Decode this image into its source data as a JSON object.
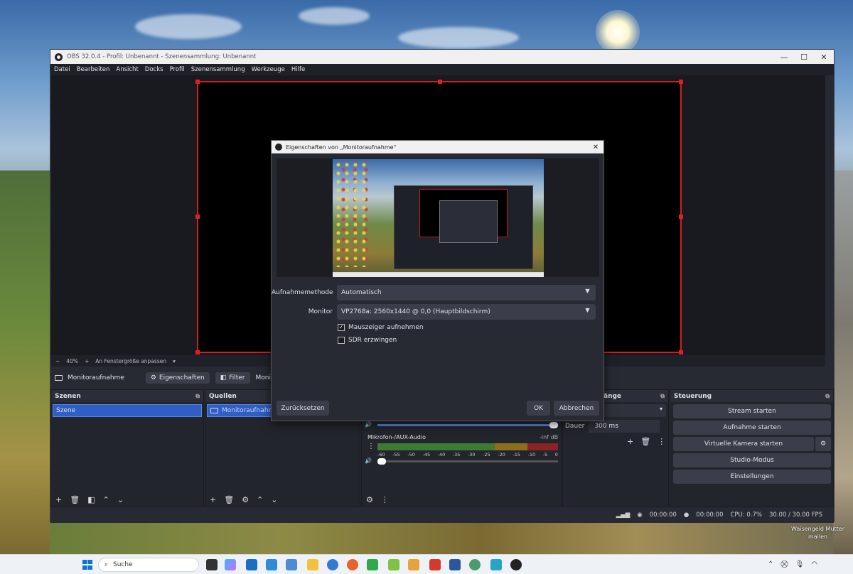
{
  "window": {
    "title": "OBS 32.0.4 - Profil: Unbenannt - Szenensammlung: Unbenannt",
    "controls": [
      "—",
      "☐",
      "✕"
    ]
  },
  "menu": [
    "Datei",
    "Bearbeiten",
    "Ansicht",
    "Docks",
    "Profil",
    "Szenensammlung",
    "Werkzeuge",
    "Hilfe"
  ],
  "zoombar": {
    "minus": "−",
    "zoom": "40%",
    "plus": "+",
    "fit": "An Fenstergröße anpassen",
    "caret": "▾"
  },
  "source_toolbar": {
    "selected_source": "Monitoraufnahme",
    "properties": "Eigenschaften",
    "filters": "Filter",
    "cut_label": "Moni"
  },
  "scenes": {
    "title": "Szenen",
    "items": [
      "Szene"
    ]
  },
  "sources": {
    "title": "Quellen",
    "items": [
      "Monitoraufnahme"
    ]
  },
  "mixer": {
    "ticks": [
      "-60",
      "-55",
      "-50",
      "-45",
      "-40",
      "-35",
      "-30",
      "-25",
      "-20",
      "-15",
      "-10",
      "-5",
      "0"
    ],
    "channel2_name": "Mikrofon-/AUX-Audio",
    "channel2_level": "-inf dB",
    "top_meter_fill": 0.97,
    "mic_volume_fill": 0.04
  },
  "transitions": {
    "title_fragment": "änge",
    "duration_label": "Dauer",
    "duration_value": "300 ms"
  },
  "controls": {
    "title": "Steuerung",
    "buttons": [
      "Stream starten",
      "Aufnahme starten",
      "Virtuelle Kamera starten",
      "Studio-Modus",
      "Einstellungen"
    ]
  },
  "status": {
    "stream_time": "00:00:00",
    "rec_time": "00:00:00",
    "cpu": "CPU: 0.7%",
    "fps": "30.00 / 30.00 FPS"
  },
  "dialog": {
    "title": "Eigenschaften von „Monitoraufnahme\"",
    "method_label": "Aufnahmemethode",
    "method_value": "Automatisch",
    "monitor_label": "Monitor",
    "monitor_value": "VP2768a: 2560x1440 @ 0,0 (Hauptbildschirm)",
    "cursor_label": "Mauszeiger aufnehmen",
    "cursor_checked": true,
    "sdr_label": "SDR erzwingen",
    "sdr_checked": false,
    "reset": "Zurücksetzen",
    "ok": "OK",
    "cancel": "Abbrechen"
  },
  "taskbar": {
    "search_placeholder": "Suche"
  },
  "desktop_note": [
    "Waisengeld Mutter",
    "mailen"
  ],
  "colors": {
    "accent": "#2f5ec4",
    "canvas_border": "#d21f1f",
    "panel": "#23252d"
  }
}
